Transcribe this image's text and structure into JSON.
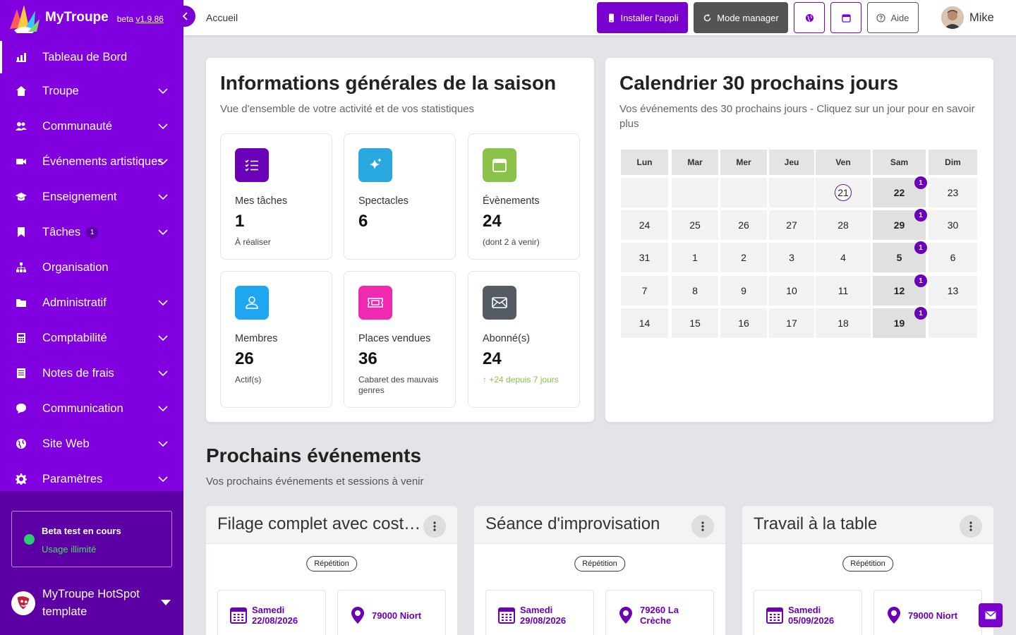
{
  "brand": {
    "name": "MyTroupe",
    "beta_prefix": "beta",
    "version": "v1.9.86"
  },
  "sidebar": {
    "items": [
      {
        "label": "Tableau de Bord",
        "icon": "chart-bar-icon",
        "active": true,
        "chevron": false
      },
      {
        "label": "Troupe",
        "icon": "home-icon",
        "chevron": true
      },
      {
        "label": "Communauté",
        "icon": "users-icon",
        "chevron": true
      },
      {
        "label": "Événements artistiques",
        "icon": "video-icon",
        "chevron": true
      },
      {
        "label": "Enseignement",
        "icon": "graduation-cap-icon",
        "chevron": true
      },
      {
        "label": "Tâches",
        "icon": "bookmark-icon",
        "chevron": true,
        "badge": "1"
      },
      {
        "label": "Organisation",
        "icon": "sitemap-icon",
        "chevron": false
      },
      {
        "label": "Administratif",
        "icon": "folder-icon",
        "chevron": true
      },
      {
        "label": "Comptabilité",
        "icon": "calculator-icon",
        "chevron": true
      },
      {
        "label": "Notes de frais",
        "icon": "receipt-icon",
        "chevron": true
      },
      {
        "label": "Communication",
        "icon": "chat-bubble-icon",
        "chevron": true
      },
      {
        "label": "Site Web",
        "icon": "globe-icon",
        "chevron": true
      },
      {
        "label": "Paramètres",
        "icon": "gear-icon",
        "chevron": true
      }
    ],
    "beta": {
      "title": "Beta test en cours",
      "subtitle": "Usage illimité"
    },
    "org_name": "MyTroupe HotSpot template"
  },
  "topbar": {
    "breadcrumb": "Accueil",
    "install_label": "Installer l'appli",
    "manager_label": "Mode manager",
    "help_label": "Aide",
    "user_name": "Mike"
  },
  "info": {
    "title": "Informations générales de la saison",
    "subtitle": "Vue d'ensemble de votre activité et de vos statistiques",
    "stats": [
      {
        "label": "Mes tâches",
        "value": "1",
        "note": "À réaliser",
        "icon": "list-icon",
        "color": "#6a00b8"
      },
      {
        "label": "Spectacles",
        "value": "6",
        "note": "",
        "icon": "sparkles-icon",
        "color": "#29a8e0"
      },
      {
        "label": "Évènements",
        "value": "24",
        "note": "(dont 2 à venir)",
        "icon": "calendar-icon",
        "color": "#8bc34a"
      },
      {
        "label": "Membres",
        "value": "26",
        "note": "Actif(s)",
        "icon": "user-icon",
        "color": "#1ea7f0"
      },
      {
        "label": "Places vendues",
        "value": "36",
        "note": "Cabaret des mauvais genres",
        "icon": "ticket-icon",
        "color": "#f02ab0"
      },
      {
        "label": "Abonné(s)",
        "value": "24",
        "note": "↑ +24 depuis 7 jours",
        "icon": "envelope-icon",
        "color": "#555b63"
      }
    ]
  },
  "calendar": {
    "title": "Calendrier 30 prochains jours",
    "subtitle": "Vos événements des 30 prochains jours - Cliquez sur un jour pour en savoir plus",
    "days": [
      "Lun",
      "Mar",
      "Mer",
      "Jeu",
      "Ven",
      "Sam",
      "Dim"
    ],
    "weeks": [
      [
        "",
        "",
        "",
        "",
        "21",
        "22",
        "23"
      ],
      [
        "24",
        "25",
        "26",
        "27",
        "28",
        "29",
        "30"
      ],
      [
        "31",
        "1",
        "2",
        "3",
        "4",
        "5",
        "6"
      ],
      [
        "7",
        "8",
        "9",
        "10",
        "11",
        "12",
        "13"
      ],
      [
        "14",
        "15",
        "16",
        "17",
        "18",
        "19",
        ""
      ]
    ],
    "today": "21",
    "event_badge": "1"
  },
  "upcoming": {
    "title": "Prochains événements",
    "subtitle": "Vos prochains événements et sessions à venir",
    "events": [
      {
        "title": "Filage complet avec costumes",
        "tag": "Répétition",
        "day": "Samedi",
        "date": "22/08/2026",
        "place": "79000 Niort"
      },
      {
        "title": "Séance d'improvisation",
        "tag": "Répétition",
        "day": "Samedi",
        "date": "29/08/2026",
        "place": "79260 La Crèche"
      },
      {
        "title": "Travail à la table",
        "tag": "Répétition",
        "day": "Samedi",
        "date": "05/09/2026",
        "place": "79000 Niort"
      }
    ]
  }
}
